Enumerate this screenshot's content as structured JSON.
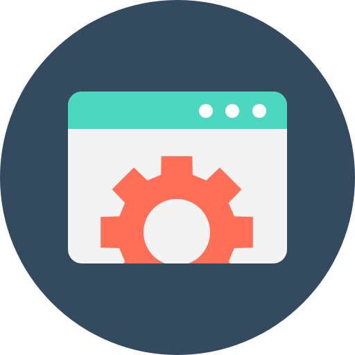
{
  "icon": {
    "name": "browser-settings-icon",
    "colors": {
      "circle": "#344A5E",
      "titlebar": "#4CD7C0",
      "window_body": "#F3F3F3",
      "dots": "#FFFFFF",
      "gear": "#FF6F57",
      "gear_hole": "#F3F3F3"
    },
    "window_dots_count": 3
  }
}
